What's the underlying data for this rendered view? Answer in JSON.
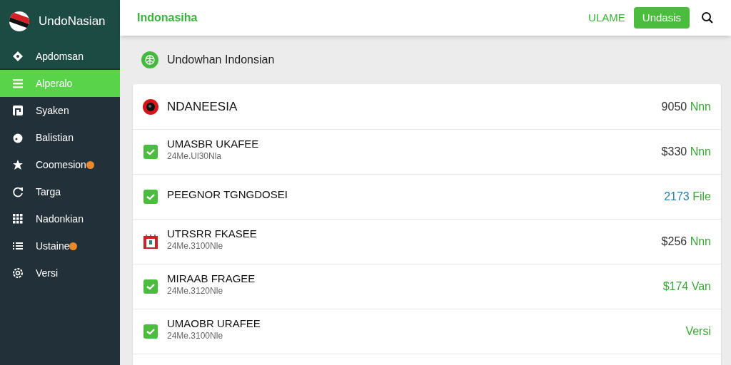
{
  "sidebar": {
    "title": "UndoNasian",
    "items": [
      {
        "label": "Apdomsan",
        "kind": "diamond",
        "selected": false,
        "badge": false
      },
      {
        "label": "Alperalo",
        "kind": "menu",
        "selected": true,
        "badge": false
      },
      {
        "label": "Syaken",
        "kind": "square",
        "selected": false,
        "badge": false
      },
      {
        "label": "Balistian",
        "kind": "blob",
        "selected": false,
        "badge": false
      },
      {
        "label": "Coomesion",
        "kind": "star",
        "selected": false,
        "badge": true
      },
      {
        "label": "Targa",
        "kind": "refresh",
        "selected": false,
        "badge": false
      },
      {
        "label": "Nadonkian",
        "kind": "grid",
        "selected": false,
        "badge": false
      },
      {
        "label": "Ustaine",
        "kind": "list",
        "selected": false,
        "badge": true
      },
      {
        "label": "Versi",
        "kind": "gear",
        "selected": false,
        "badge": false
      }
    ]
  },
  "header": {
    "title": "Indonasiha",
    "link": "ULAME",
    "button": "Undasis"
  },
  "section": {
    "title": "Undowhan Indonsian"
  },
  "rows": [
    {
      "kind": "record",
      "title": "NDANEESIA",
      "amount": "9050",
      "color": "#333333",
      "unit": "Nnn"
    },
    {
      "kind": "check",
      "title": "UMASBR UKAFEE",
      "subtitle": "24Me.Ul30Nla",
      "amount": "$330",
      "color": "#333333",
      "unit": "Nnn"
    },
    {
      "kind": "check",
      "title": "PEEGNOR TGNGDOSEI",
      "amount": "2173",
      "color": "#2b7fb0",
      "unit": "File"
    },
    {
      "kind": "calendar",
      "title": "UTRSRR FKASEE",
      "subtitle": "24Me.3100Nle",
      "amount": "$256",
      "color": "#333333",
      "unit": "Nnn"
    },
    {
      "kind": "check",
      "title": "MIRAAB FRAGEE",
      "subtitle": "24Me.3120Nle",
      "amount": "$174",
      "color": "#3aa935",
      "unit": "Van"
    },
    {
      "kind": "check",
      "title": "UMAOBR URAFEE",
      "subtitle": "24Me.3100Nle",
      "unit": "Versi"
    }
  ]
}
